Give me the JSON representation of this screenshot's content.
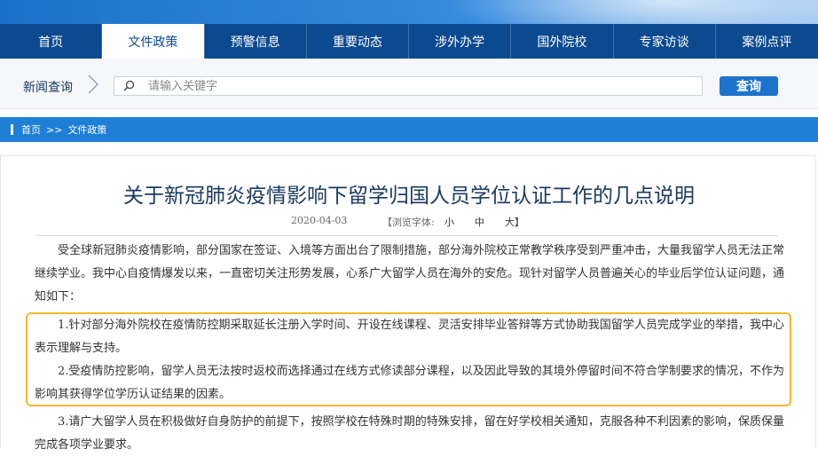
{
  "nav": {
    "items": [
      {
        "label": "首页"
      },
      {
        "label": "文件政策"
      },
      {
        "label": "预警信息"
      },
      {
        "label": "重要动态"
      },
      {
        "label": "涉外办学"
      },
      {
        "label": "国外院校"
      },
      {
        "label": "专家访谈"
      },
      {
        "label": "案例点评"
      }
    ],
    "active_index": 1
  },
  "search": {
    "label": "新闻查询",
    "placeholder": "请输入关键字",
    "value": "",
    "button_label": "查询"
  },
  "breadcrumb": {
    "home": "首页",
    "separator": ">>",
    "current": "文件政策"
  },
  "article": {
    "title": "关于新冠肺炎疫情影响下留学归国人员学位认证工作的几点说明",
    "date": "2020-04-03",
    "font_label": "【浏览字体:",
    "font_small": "小",
    "font_medium": "中",
    "font_large": "大】",
    "paragraphs": [
      "受全球新冠肺炎疫情影响，部分国家在签证、入境等方面出台了限制措施，部分海外院校正常教学秩序受到严重冲击，大量我留学人员无法正常继续学业。我中心自疫情爆发以来，一直密切关注形势发展，心系广大留学人员在海外的安危。现针对留学人员普遍关心的毕业后学位认证问题，通知如下：",
      "1.针对部分海外院校在疫情防控期采取延长注册入学时间、开设在线课程、灵活安排毕业答辩等方式协助我国留学人员完成学业的举措，我中心表示理解与支持。",
      "2.受疫情防控影响，留学人员无法按时返校而选择通过在线方式修读部分课程，以及因此导致的其境外停留时间不符合学制要求的情况，不作为影响其获得学位学历认证结果的因素。",
      "3.请广大留学人员在积极做好自身防护的前提下，按照学校在特殊时期的特殊安排，留在好学校相关通知，克服各种不利因素的影响，保质保量完成各项学业要求。"
    ]
  },
  "colors": {
    "nav_bg": "#0c4a90",
    "accent": "#1e7fd6",
    "highlight": "#f5b82e",
    "title": "#1b3a60"
  }
}
